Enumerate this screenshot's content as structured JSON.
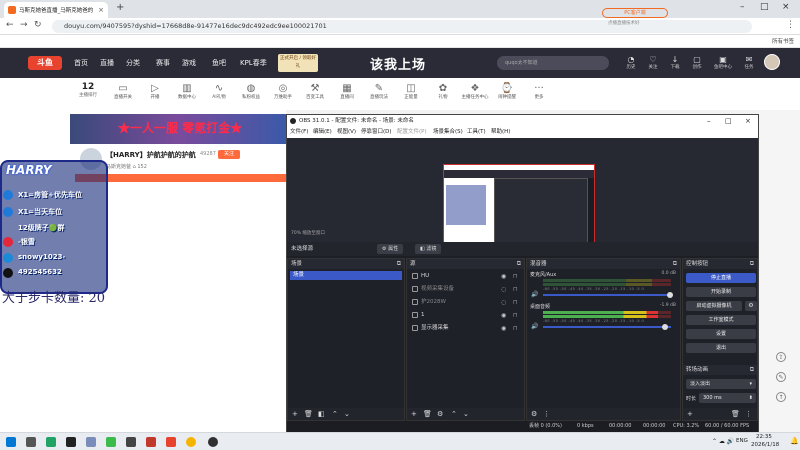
{
  "browser": {
    "tab_title": "马斯克她爸直播_马斯克她爸的",
    "url": "douyu.com/9407595?dyshid=17668d8e-91477e16dec9dc492edc9ee100021701",
    "bookmarks_label": "所有书签"
  },
  "douyu": {
    "logo": "斗鱼",
    "nav": [
      "首页",
      "直播",
      "分类",
      "赛事",
      "游戏",
      "鱼吧",
      "KPL春季"
    ],
    "promo": "正式开启 / 领取好礼",
    "slogan": "该我上场",
    "search_placeholder": "quqo太不知道",
    "right_icons": [
      {
        "glyph": "◔",
        "label": "历史"
      },
      {
        "glyph": "♡",
        "label": "关注"
      },
      {
        "glyph": "↓",
        "label": "下载"
      },
      {
        "glyph": "▢",
        "label": "创作"
      },
      {
        "glyph": "▣",
        "label": "鱼吧中心"
      },
      {
        "glyph": "✉",
        "label": "任务"
      }
    ],
    "category_count": "12",
    "category_count_label": "主播排行",
    "categories": [
      {
        "glyph": "▭",
        "label": "直播开关"
      },
      {
        "glyph": "▷",
        "label": "开播"
      },
      {
        "glyph": "▥",
        "label": "数据中心"
      },
      {
        "glyph": "∿",
        "label": "AI礼物"
      },
      {
        "glyph": "◍",
        "label": "私粉权益"
      },
      {
        "glyph": "◎",
        "label": "万维助手"
      },
      {
        "glyph": "⚒",
        "label": "百变工具"
      },
      {
        "glyph": "▦",
        "label": "直播间"
      },
      {
        "glyph": "✎",
        "label": "直播玩法"
      },
      {
        "glyph": "◫",
        "label": "正能量"
      },
      {
        "glyph": "✿",
        "label": "礼物"
      },
      {
        "glyph": "❖",
        "label": "主播任务中心"
      },
      {
        "glyph": "⌚",
        "label": "闹钟提醒"
      },
      {
        "glyph": "···",
        "label": "更多"
      }
    ],
    "pc_button": "PC客户端",
    "pc_sub": "点播直播技术好"
  },
  "stream": {
    "banner_text": "★一人一服 零氪打金★",
    "title": "【HARRY】护航护航的护航",
    "badge": "49287",
    "follow": "关注",
    "meta": "马斯克她爸   ⌂ 152"
  },
  "overlay": {
    "title": "HARRY",
    "lines": [
      "X1=房管+优先车位",
      "X1=当天车位",
      "12级牌子🟢群",
      "-银雪",
      "snowy1023-",
      "492545632"
    ],
    "caption": "大于步卡数量: 20"
  },
  "obs": {
    "title": "OBS 31.0.1 - 配置文件: 未命名 - 场景: 未命名",
    "menu": [
      "文件(F)",
      "编辑(E)",
      "视图(V)",
      "停靠窗口(D)",
      "配置文件(P)",
      "场景集合(S)",
      "工具(T)",
      "帮助(H)"
    ],
    "zoom": "70% 缩放至窗口",
    "no_source": "未选择源",
    "props_btn": "⚙ 属性",
    "filters_btn": "◧ 滤镜",
    "docks": {
      "scenes": "场景",
      "sources": "源",
      "mixer": "混音器",
      "controls": "控制按钮"
    },
    "scene_items": [
      "场景"
    ],
    "sources": [
      {
        "label": "HU",
        "dim": false
      },
      {
        "label": "视频采集设备",
        "dim": true
      },
      {
        "label": "护2028W",
        "dim": true
      },
      {
        "label": "1",
        "dim": false
      },
      {
        "label": "显示器采集",
        "dim": false
      }
    ],
    "mixer": [
      {
        "name": "麦克风/Aux",
        "db": "0.0 dB",
        "level": 0.0
      },
      {
        "name": "桌面音频",
        "db": "-1.9 dB",
        "level": 0.9
      }
    ],
    "scale": "-60 -55 -50 -45 -40 -35 -30 -25 -20 -15 -10 -5 0",
    "controls": [
      "停止直播",
      "开始录制",
      "启动虚拟摄像机",
      "工作室模式",
      "设置",
      "退出"
    ],
    "transitions_title": "转场动画",
    "transition": "淡入淡出",
    "duration_label": "时长",
    "duration": "300 ms",
    "status": {
      "frames": "丢帧 0 (0.0%)",
      "kbps": "0 kbps",
      "rec": "00:00:00",
      "live": "00:00:00",
      "cpu": "CPU: 3.2%",
      "fps": "60.00 / 60.00 FPS"
    }
  },
  "taskbar": {
    "lang": "ENG",
    "time": "22:35",
    "date": "2026/1/18"
  }
}
